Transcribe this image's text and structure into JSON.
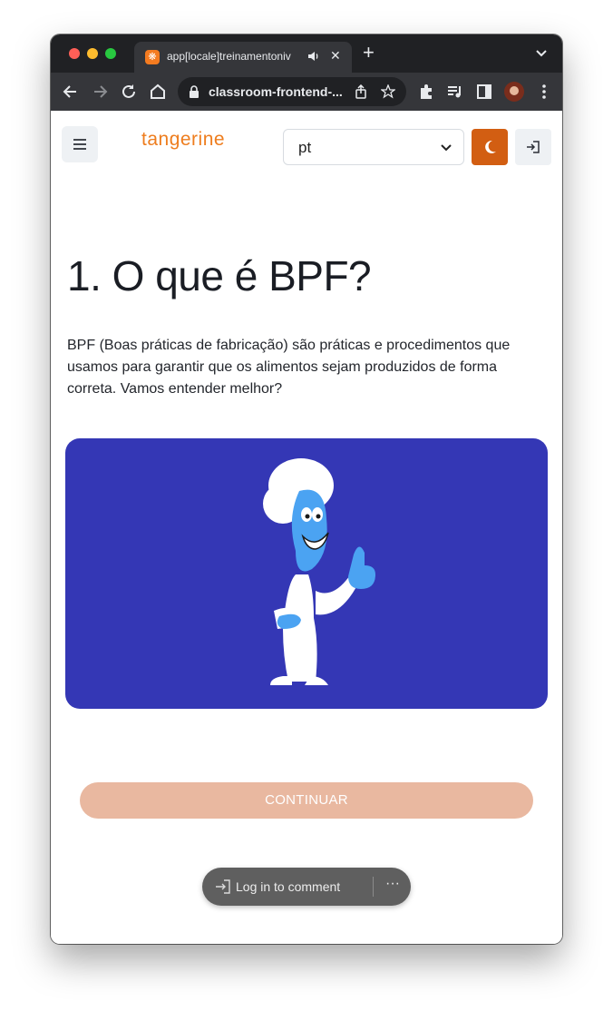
{
  "browser": {
    "tab_title": "app[locale]treinamentoniv",
    "new_tab": "+",
    "close": "✕",
    "url": "classroom-frontend-...",
    "favicon": "tangerine-favicon-icon"
  },
  "header": {
    "brand": "tangerine",
    "language": "pt",
    "menu_icon": "hamburger-icon",
    "theme_icon": "moon-icon",
    "login_icon": "log-in-icon"
  },
  "lesson": {
    "title": "1. O que é BPF?",
    "intro": "BPF (Boas práticas de fabricação) são práticas e procedimentos que usamos para garantir que os alimentos sejam produzidos de forma correta. Vamos entender melhor?",
    "continue_label": "CONTINUAR"
  },
  "comment_bar": {
    "label": "Log in to comment",
    "more": "···"
  },
  "colors": {
    "brand": "#ee7d1e",
    "theme_button": "#d25e12",
    "continue_button": "#e9b8a0",
    "illustration_bg": "#3437b5"
  }
}
